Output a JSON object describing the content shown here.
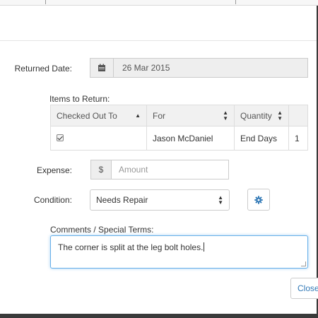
{
  "form": {
    "returned_date": {
      "label": "Returned Date:",
      "value": "26 Mar 2015",
      "icon": "calendar-icon"
    },
    "items": {
      "label": "Items to Return:",
      "columns": [
        "Checked Out To",
        "For",
        "Quantity"
      ],
      "rows": [
        {
          "checked": true,
          "checked_out_to": "",
          "for": "Jason McDaniel",
          "quantity": "End Days",
          "extra": "1"
        }
      ]
    },
    "expense": {
      "label": "Expense:",
      "currency": "$",
      "placeholder": "Amount"
    },
    "condition": {
      "label": "Condition:",
      "value": "Needs Repair",
      "icon": "gear-icon"
    },
    "comments": {
      "label": "Comments / Special Terms:",
      "value": "The corner is split at the leg bolt holes."
    },
    "close_label": "Close"
  },
  "colors": {
    "accent": "#337ab7",
    "focus": "#66afe9"
  }
}
